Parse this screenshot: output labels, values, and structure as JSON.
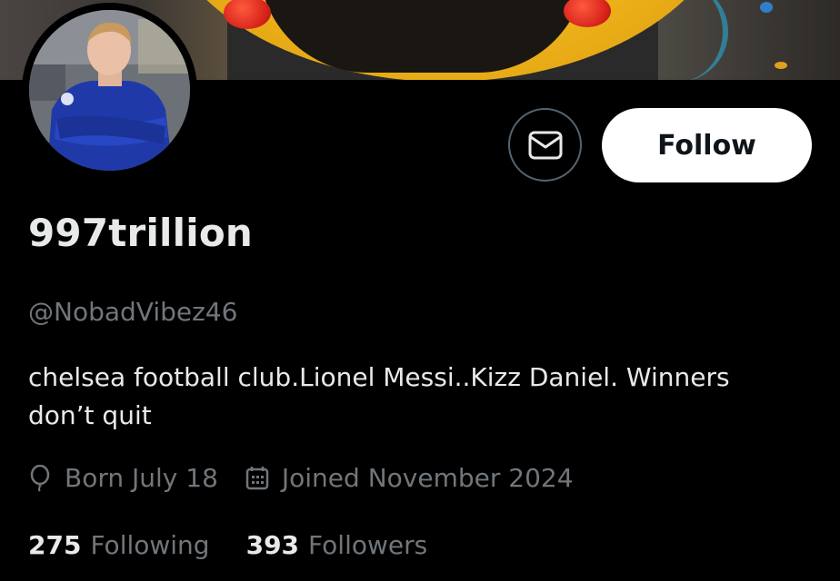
{
  "profile": {
    "display_name": "997trillion",
    "handle": "@NobadVibez46",
    "bio": "chelsea football club.Lionel Messi..Kizz Daniel. Winners don’t quit",
    "born": "Born July 18",
    "joined": "Joined November 2024"
  },
  "actions": {
    "follow_label": "Follow",
    "message_icon": "envelope-icon"
  },
  "stats": {
    "following_count": "275",
    "following_label": "Following",
    "followers_count": "393",
    "followers_label": "Followers"
  },
  "colors": {
    "background": "#000000",
    "primary_text": "#e7e9ea",
    "secondary_text": "#71767b",
    "button_bg": "#ffffff",
    "button_border": "#536471"
  }
}
